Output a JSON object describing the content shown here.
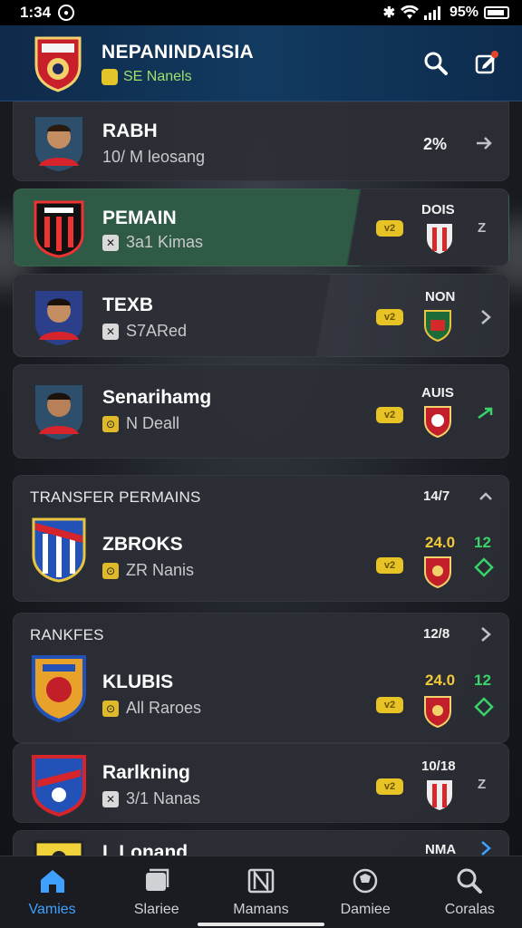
{
  "status": {
    "time": "1:34",
    "battery": "95%"
  },
  "header": {
    "title": "NEPANINDAISIA",
    "subtitle": "SE Nanels"
  },
  "colors": {
    "accent": "#3ea1ff",
    "gold": "#f3c93a",
    "green": "#39d36b",
    "activeRow": "#2f5a46"
  },
  "players": [
    {
      "name": "RABH",
      "sub": "10/ M leosang",
      "right": "2%"
    },
    {
      "name": "PEMAIN",
      "sub": "3a1 Kimas",
      "head": "DOIS"
    },
    {
      "name": "TEXB",
      "sub": "S7ARed",
      "head": "NON"
    },
    {
      "name": "Senarihamg",
      "sub": "N Deall",
      "head": "AUIS"
    }
  ],
  "sections": [
    {
      "title": "TRANSFER PERMAINS",
      "col": "14/7",
      "club": "ZBROKS",
      "sub": "ZR Nanis",
      "gold": "24.0",
      "green": "12"
    },
    {
      "title": "RANKFES",
      "col": "12/8",
      "club": "KLUBIS",
      "sub": "All Raroes",
      "gold": "24.0",
      "green": "12"
    }
  ],
  "ranking": {
    "name": "Rarlkning",
    "sub": "3/1 Nanas",
    "head": "10/18"
  },
  "last_row": {
    "name": "L Lonand",
    "head": "NMA"
  },
  "nav": [
    {
      "label": "Vamies",
      "icon": "home-icon"
    },
    {
      "label": "Slariee",
      "icon": "card-icon"
    },
    {
      "label": "Mamans",
      "icon": "pitch-icon"
    },
    {
      "label": "Damiee",
      "icon": "ball-icon"
    },
    {
      "label": "Coralas",
      "icon": "search-icon"
    }
  ]
}
